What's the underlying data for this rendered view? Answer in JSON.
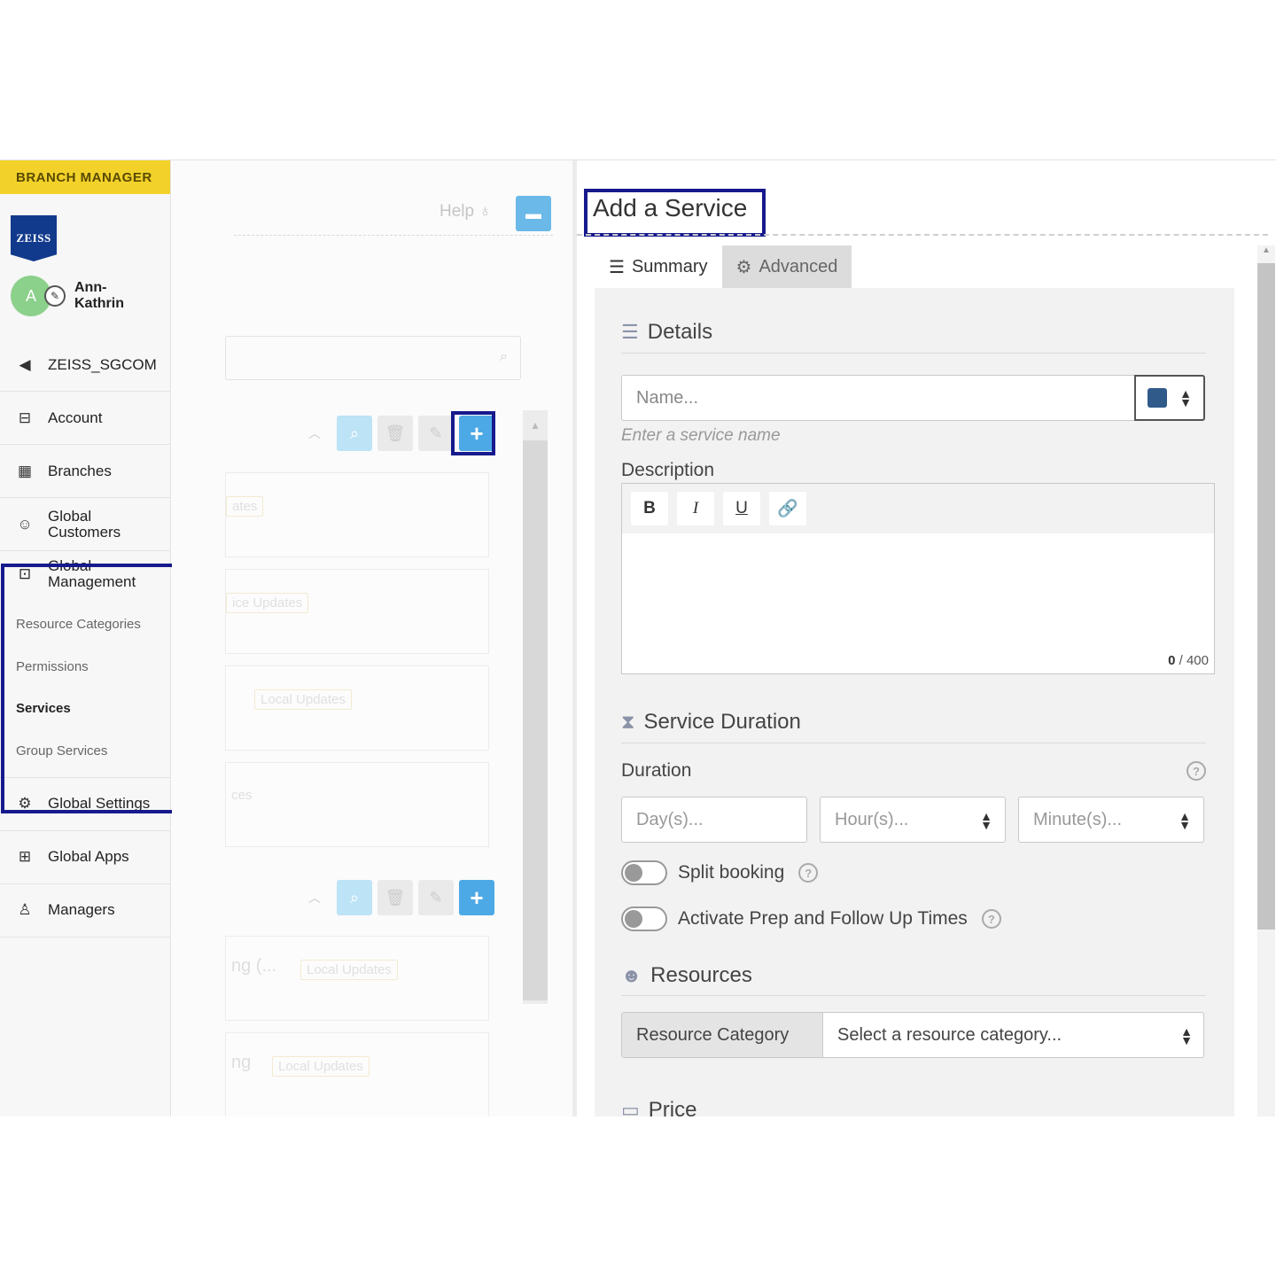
{
  "sidebar": {
    "role": "BRANCH MANAGER",
    "logo_text": "ZEISS",
    "user_initial": "A",
    "user_name": "Ann-Kathrin",
    "items": [
      {
        "label": "ZEISS_SGCOM",
        "icon": "back-circle-icon"
      },
      {
        "label": "Account",
        "icon": "briefcase-icon"
      },
      {
        "label": "Branches",
        "icon": "building-icon"
      },
      {
        "label": "Global Customers",
        "icon": "users-icon"
      }
    ],
    "global_management": {
      "label": "Global Management",
      "icon": "suitcase-icon",
      "sub": [
        "Resource Categories",
        "Permissions",
        "Services",
        "Group Services"
      ],
      "active": "Services"
    },
    "bottom_items": [
      {
        "label": "Global Settings",
        "icon": "gears-icon"
      },
      {
        "label": "Global Apps",
        "icon": "grid-icon"
      },
      {
        "label": "Managers",
        "icon": "user-tie-icon"
      }
    ]
  },
  "middle": {
    "help_label": "Help",
    "tags": [
      "ates",
      "ice Updates",
      "Local Updates",
      "ces",
      "Local Updates",
      "Local Updates"
    ],
    "snippets": [
      "ng (...",
      "ng"
    ]
  },
  "form": {
    "title": "Add a Service",
    "tabs": [
      {
        "label": "Summary",
        "icon": "list-icon"
      },
      {
        "label": "Advanced",
        "icon": "gears-icon"
      }
    ],
    "details_title": "Details",
    "name_placeholder": "Name...",
    "name_hint": "Enter a service name",
    "color_value": "#2f5a8a",
    "description_label": "Description",
    "format_buttons": [
      "B",
      "I",
      "U"
    ],
    "counter_current": "0",
    "counter_max": "/ 400",
    "duration_title": "Service Duration",
    "duration_label": "Duration",
    "days_placeholder": "Day(s)...",
    "hours_placeholder": "Hour(s)...",
    "minutes_placeholder": "Minute(s)...",
    "split_booking": "Split booking",
    "prep_times": "Activate Prep and Follow Up Times",
    "resources_title": "Resources",
    "resource_category_label": "Resource Category",
    "resource_category_placeholder": "Select a resource category...",
    "price_title": "Price"
  },
  "colors": {
    "accent_yellow": "#f2d22a",
    "primary_blue": "#4da9e6",
    "highlight_navy": "#161a8c"
  }
}
